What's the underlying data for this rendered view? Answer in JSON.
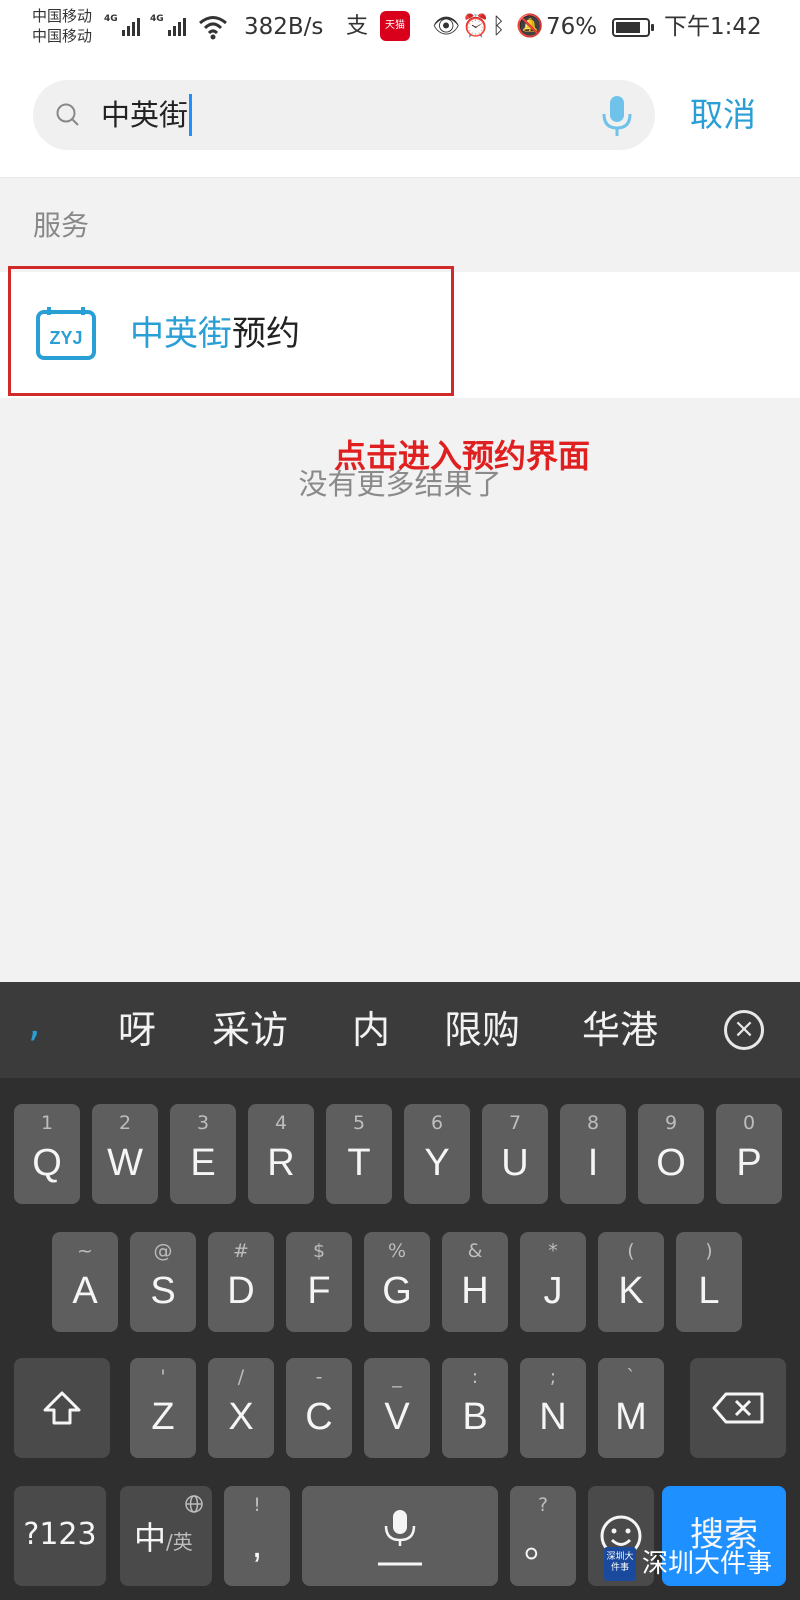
{
  "status_bar": {
    "carrier_1": "中国移动",
    "carrier_2": "中国移动",
    "network_1": "4G",
    "network_2": "4G",
    "speed": "382B/s",
    "battery": "76%",
    "time": "下午1:42",
    "tmall_label": "天猫"
  },
  "search": {
    "query": "中英街",
    "cancel_label": "取消"
  },
  "results": {
    "section_label": "服务",
    "item": {
      "icon_text": "ZYJ",
      "title_highlight": "中英街",
      "title_rest": "预约"
    },
    "no_more": "没有更多结果了"
  },
  "annotation": "点击进入预约界面",
  "keyboard": {
    "candidate_comma": ",",
    "candidates": [
      "呀",
      "采访",
      "内",
      "限购",
      "华港"
    ],
    "row1": [
      {
        "main": "Q",
        "sub": "1"
      },
      {
        "main": "W",
        "sub": "2"
      },
      {
        "main": "E",
        "sub": "3"
      },
      {
        "main": "R",
        "sub": "4"
      },
      {
        "main": "T",
        "sub": "5"
      },
      {
        "main": "Y",
        "sub": "6"
      },
      {
        "main": "U",
        "sub": "7"
      },
      {
        "main": "I",
        "sub": "8"
      },
      {
        "main": "O",
        "sub": "9"
      },
      {
        "main": "P",
        "sub": "0"
      }
    ],
    "row2": [
      {
        "main": "A",
        "sub": "~"
      },
      {
        "main": "S",
        "sub": "@"
      },
      {
        "main": "D",
        "sub": "#"
      },
      {
        "main": "F",
        "sub": "$"
      },
      {
        "main": "G",
        "sub": "%"
      },
      {
        "main": "H",
        "sub": "&"
      },
      {
        "main": "J",
        "sub": "*"
      },
      {
        "main": "K",
        "sub": "("
      },
      {
        "main": "L",
        "sub": ")"
      }
    ],
    "row3": [
      {
        "main": "Z",
        "sub": "'"
      },
      {
        "main": "X",
        "sub": "/"
      },
      {
        "main": "C",
        "sub": "-"
      },
      {
        "main": "V",
        "sub": "_"
      },
      {
        "main": "B",
        "sub": ":"
      },
      {
        "main": "N",
        "sub": ";"
      },
      {
        "main": "M",
        "sub": "`"
      }
    ],
    "num_label": "?123",
    "lang_main": "中",
    "lang_sub": "/英",
    "comma_key": {
      "main": ",",
      "sub": "!"
    },
    "period_key": {
      "main": "。",
      "sub": "?"
    },
    "search_label": "搜索"
  },
  "watermark": {
    "badge": "深圳大件事",
    "text": "深圳大件事"
  },
  "colors": {
    "accent": "#2a9fd6",
    "annotation": "#e02020",
    "keyboard_bg": "#2f2f2f",
    "key_bg": "#5e5e5e",
    "search_key": "#1e90ff"
  }
}
